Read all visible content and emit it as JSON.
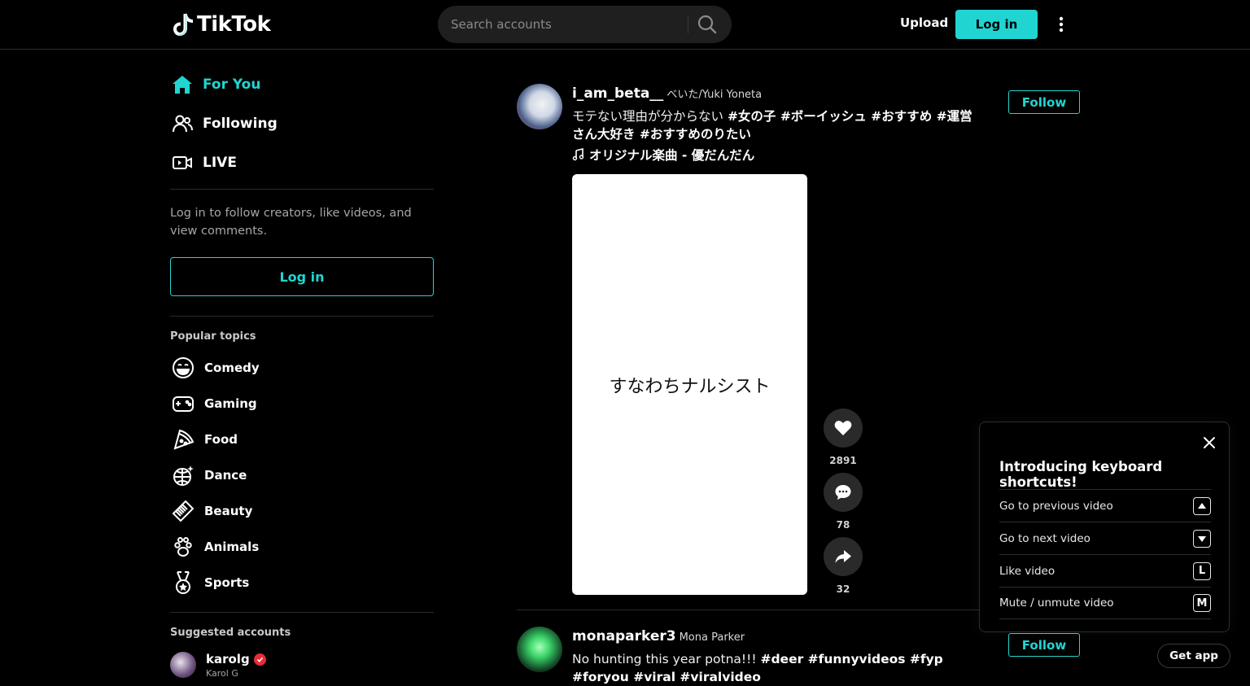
{
  "header": {
    "logo_text": "TikTok",
    "search_placeholder": "Search accounts",
    "upload_label": "Upload",
    "login_label": "Log in"
  },
  "sidebar": {
    "nav": [
      {
        "label": "For You",
        "icon": "home-icon",
        "active": true
      },
      {
        "label": "Following",
        "icon": "users-icon",
        "active": false
      },
      {
        "label": "LIVE",
        "icon": "live-camera-icon",
        "active": false
      }
    ],
    "login_hint": "Log in to follow creators, like videos, and view comments.",
    "login_button": "Log in",
    "popular_topics_title": "Popular topics",
    "topics": [
      {
        "label": "Comedy",
        "icon": "smile-face-icon"
      },
      {
        "label": "Gaming",
        "icon": "gamepad-icon"
      },
      {
        "label": "Food",
        "icon": "pizza-icon"
      },
      {
        "label": "Dance",
        "icon": "disco-ball-icon"
      },
      {
        "label": "Beauty",
        "icon": "comb-icon"
      },
      {
        "label": "Animals",
        "icon": "paw-icon"
      },
      {
        "label": "Sports",
        "icon": "medal-icon"
      }
    ],
    "suggested_title": "Suggested accounts",
    "suggested": [
      {
        "username": "karolg",
        "name": "Karol G",
        "verified": true
      }
    ]
  },
  "feed": {
    "posts": [
      {
        "username": "i_am_beta__",
        "nickname": "べいた/Yuki Yoneta",
        "caption_plain": "モテない理由が分からない ",
        "caption_tags": "#女の子 #ボーイッシュ #おすすめ #運営さん大好き #おすすめのりたい",
        "music": "オリジナル楽曲 - 優だんだん",
        "video_text": "すなわちナルシスト",
        "likes": "2891",
        "comments": "78",
        "shares": "32",
        "follow_label": "Follow"
      },
      {
        "username": "monaparker3",
        "nickname": "Mona Parker",
        "caption_plain": "No hunting this year potna!!! ",
        "caption_tags": "#deer #funnyvideos #fyp #foryou #viral #viralvideo",
        "follow_label": "Follow"
      }
    ]
  },
  "shortcuts_panel": {
    "title": "Introducing keyboard shortcuts!",
    "rows": [
      {
        "label": "Go to previous video",
        "key": "▲",
        "icon": "arrow-up-key-icon"
      },
      {
        "label": "Go to next video",
        "key": "▼",
        "icon": "arrow-down-key-icon"
      },
      {
        "label": "Like video",
        "key": "L",
        "icon": "l-key-icon"
      },
      {
        "label": "Mute / unmute video",
        "key": "M",
        "icon": "m-key-icon"
      }
    ]
  },
  "get_app_label": "Get app",
  "colors": {
    "accent": "#20d5d1",
    "background": "#000000",
    "verified": "#ea2b34"
  }
}
